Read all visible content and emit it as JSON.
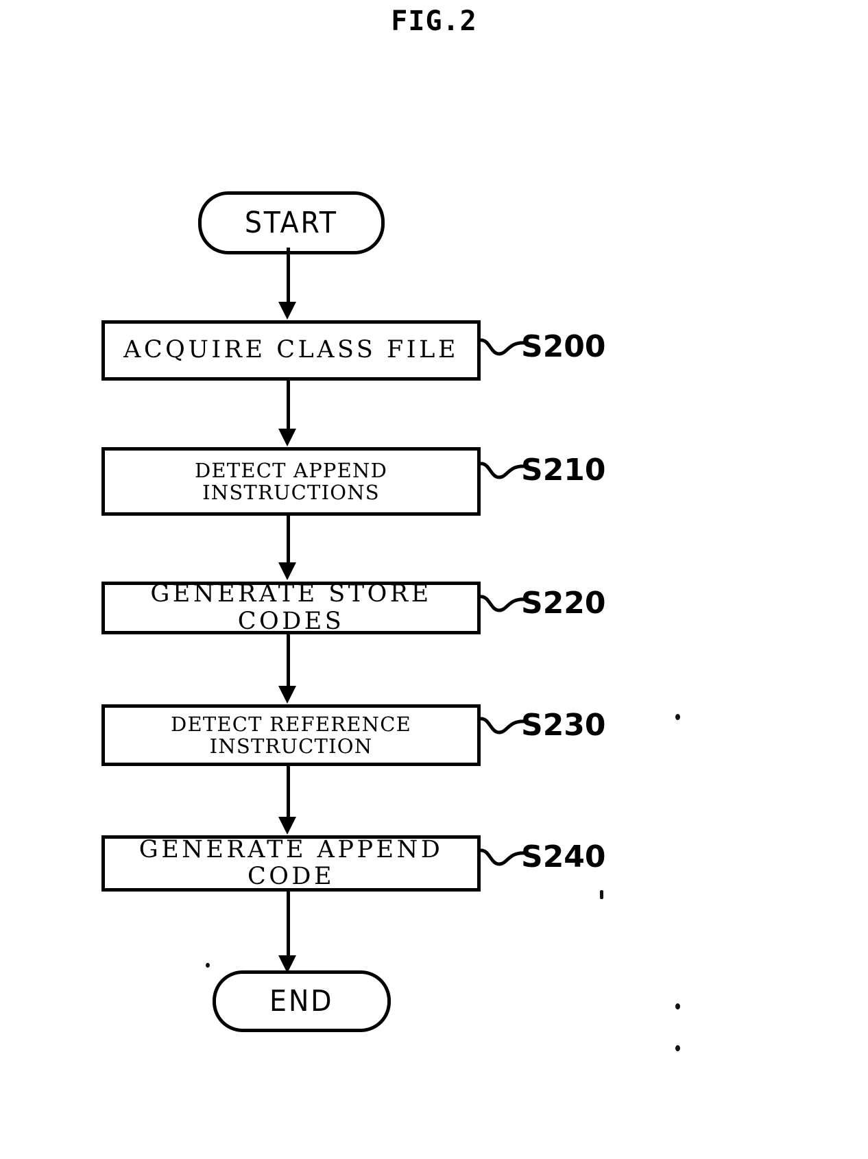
{
  "figure": {
    "title": "FIG.2"
  },
  "flowchart": {
    "start": {
      "label": "START"
    },
    "end": {
      "label": "END"
    },
    "steps": [
      {
        "id": "s200",
        "text": "ACQUIRE CLASS FILE",
        "ref": "S200",
        "lines": 1
      },
      {
        "id": "s210",
        "text": "DETECT APPEND\nINSTRUCTIONS",
        "ref": "S210",
        "lines": 2
      },
      {
        "id": "s220",
        "text": "GENERATE STORE CODES",
        "ref": "S220",
        "lines": 1
      },
      {
        "id": "s230",
        "text": "DETECT REFERENCE\nINSTRUCTION",
        "ref": "S230",
        "lines": 2
      },
      {
        "id": "s240",
        "text": "GENERATE APPEND CODE",
        "ref": "S240",
        "lines": 1
      }
    ]
  },
  "style": {
    "ink": "#000000",
    "paper": "#ffffff"
  }
}
